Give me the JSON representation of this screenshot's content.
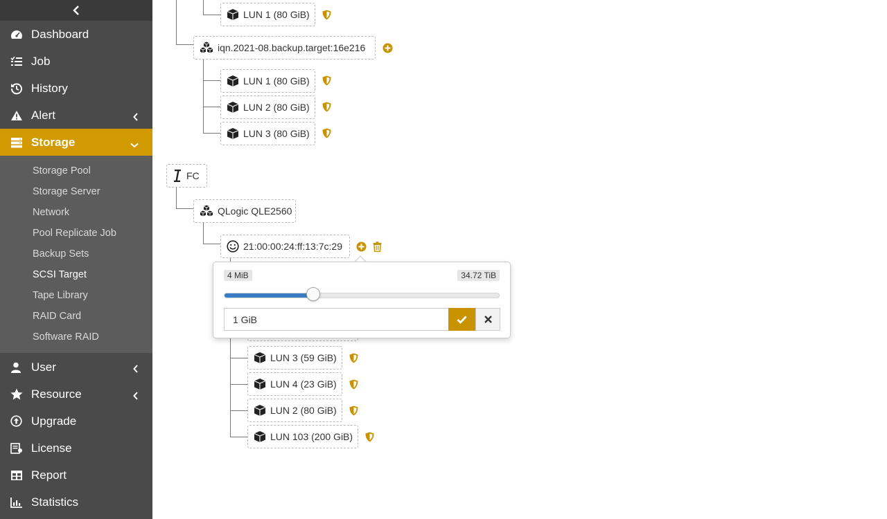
{
  "sidebar": {
    "collapse_icon": "chevron-left-icon",
    "items": [
      {
        "label": "Dashboard",
        "icon": "gauge-icon"
      },
      {
        "label": "Job",
        "icon": "task-list-icon"
      },
      {
        "label": "History",
        "icon": "history-icon"
      },
      {
        "label": "Alert",
        "icon": "warning-icon"
      },
      {
        "label": "Storage",
        "icon": "server-icon",
        "active": true
      },
      {
        "label": "User",
        "icon": "user-icon"
      },
      {
        "label": "Resource",
        "icon": "star-icon"
      },
      {
        "label": "Upgrade",
        "icon": "upgrade-icon"
      },
      {
        "label": "License",
        "icon": "license-icon"
      },
      {
        "label": "Report",
        "icon": "table-icon"
      },
      {
        "label": "Statistics",
        "icon": "bar-chart-icon"
      }
    ],
    "storage_submenu": [
      {
        "label": "Storage Pool"
      },
      {
        "label": "Storage Server"
      },
      {
        "label": "Network"
      },
      {
        "label": "Pool Replicate Job"
      },
      {
        "label": "Backup Sets"
      },
      {
        "label": "SCSI Target",
        "current": true
      },
      {
        "label": "Tape Library"
      },
      {
        "label": "RAID Card"
      },
      {
        "label": "Software RAID"
      }
    ]
  },
  "tree": {
    "iscsi_lun_top": "LUN 1 (80 GiB)",
    "backup_target": "iqn.2021-08.backup.target:16e216",
    "backup_luns": [
      "LUN 1 (80 GiB)",
      "LUN 2 (80 GiB)",
      "LUN 3 (80 GiB)"
    ],
    "fc_label": "FC",
    "fc_adapter": "QLogic QLE2560",
    "fc_wwn": "21:00:00:24:ff:13:7c:29",
    "fc_luns": [
      "LUN 3 (59 GiB)",
      "LUN 4 (23 GiB)",
      "LUN 2 (80 GiB)",
      "LUN 103 (200 GiB)"
    ]
  },
  "popover": {
    "min_label": "4 MiB",
    "max_label": "34.72 TiB",
    "slider_fraction": 0.325,
    "input_value": "1 GiB"
  },
  "colors": {
    "sidebar_bg": "#4a4a4a",
    "active_bg": "#d09a00",
    "accent": "#c99300",
    "slider_fill": "#3a7cc4"
  }
}
